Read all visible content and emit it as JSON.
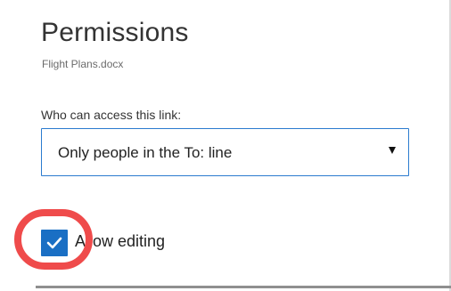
{
  "panel": {
    "title": "Permissions",
    "file_name": "Flight Plans.docx"
  },
  "access": {
    "label": "Who can access this link:",
    "selected": "Only people in the To: line",
    "arrow_icon": "caret-down-icon"
  },
  "editing": {
    "label": "Allow editing",
    "checked": true,
    "check_icon": "checkmark-icon"
  },
  "colors": {
    "accent": "#2b7bcf",
    "checkbox_fill": "#1a6fc4",
    "highlight": "#ef4b4b"
  }
}
